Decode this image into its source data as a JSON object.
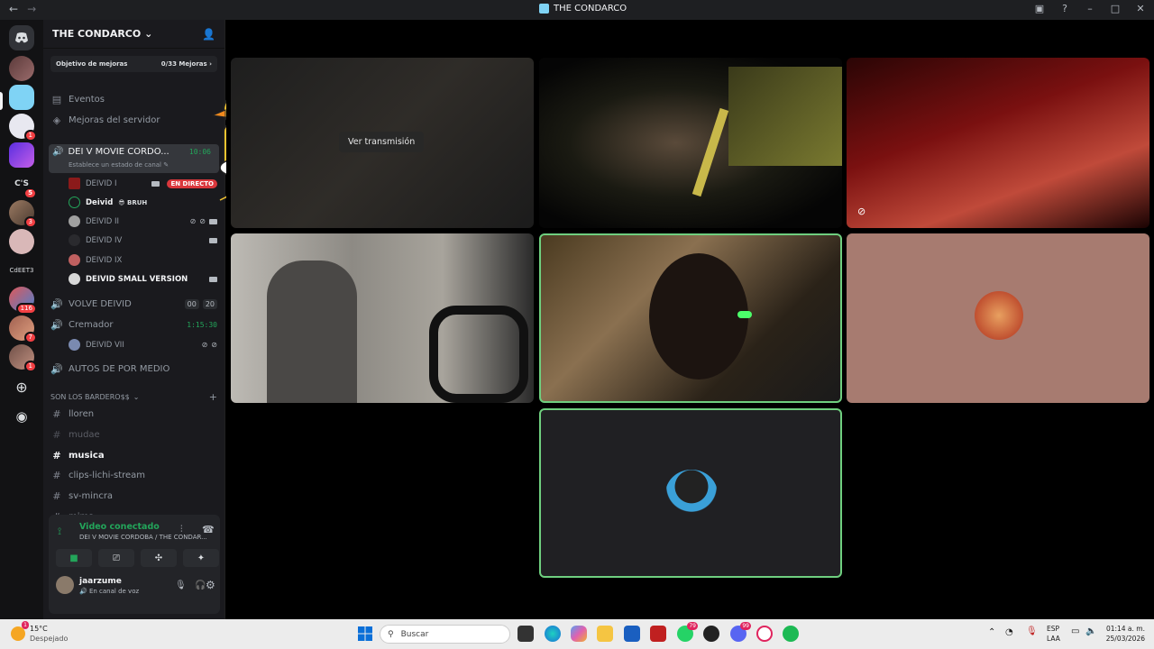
{
  "window": {
    "title": "THE CONDARCO"
  },
  "server": {
    "name": "THE CONDARCO",
    "boost_label": "Objetivo de mejoras",
    "boost_progress": "0/33 Mejoras",
    "events_label": "Eventos",
    "server_boosts_label": "Mejoras del servidor"
  },
  "rail_badges": [
    "1",
    "5",
    "3",
    "116",
    "7",
    "1"
  ],
  "rail_text": [
    "C'S",
    "CdEET3"
  ],
  "voice_channels": [
    {
      "name": "DEI V MOVIE CORDO...",
      "timer": "10:06",
      "status": "Establece un estado de canal"
    },
    {
      "name": "VOLVE DEIVID",
      "counts": [
        "00",
        "20"
      ]
    },
    {
      "name": "Cremador",
      "timer": "1:15:30"
    },
    {
      "name": "AUTOS DE POR MEDIO"
    }
  ],
  "voice_users": [
    {
      "name": "DEIVID I",
      "live": "EN DIRECTO"
    },
    {
      "name": "Deivid",
      "tag": "BRUH"
    },
    {
      "name": "DEIVID II"
    },
    {
      "name": "DEIVID IV"
    },
    {
      "name": "DEIVID IX"
    },
    {
      "name": "DEIVID SMALL VERSION"
    },
    {
      "name": "DEIVID VII"
    }
  ],
  "category": {
    "name": "SON LOS BARDERO$$"
  },
  "text_channels": [
    "lloren",
    "mudae",
    "musica",
    "clips-lichi-stream",
    "sv-mincra",
    "mims"
  ],
  "voice_panel": {
    "status": "Video conectado",
    "location": "DEI V MOVIE CORDOBA / THE CONDAR..."
  },
  "user": {
    "name": "jaarzume",
    "status": "En canal de voz"
  },
  "stream_tile": {
    "button": "Ver transmisión"
  },
  "taskbar": {
    "weather_temp": "15°C",
    "weather_desc": "Despejado",
    "weather_badge": "1",
    "search_placeholder": "Buscar",
    "lang1": "ESP",
    "lang2": "LAA",
    "time": "01:14 a. m.",
    "date": "25/03/2026",
    "badges": {
      "whatsapp": "79",
      "discord": "99"
    }
  },
  "colors": {
    "accent_green": "#23a55a",
    "live_red": "#da373c",
    "speaking_border": "#6fcf7f"
  }
}
